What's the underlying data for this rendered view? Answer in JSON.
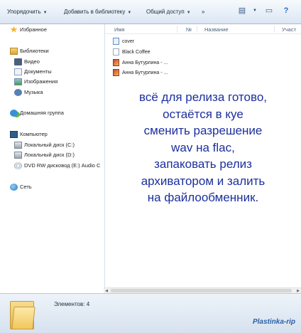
{
  "toolbar": {
    "organize": "Упорядочить",
    "add_to_library": "Добавить в библиотеку",
    "share": "Общий доступ",
    "more": "»"
  },
  "nav": {
    "favorites": "Избранное",
    "libraries": "Библиотеки",
    "video": "Видео",
    "documents": "Документы",
    "images": "Изображения",
    "music": "Музыка",
    "homegroup": "Домашняя группа",
    "computer": "Компьютер",
    "disk_c": "Локальный диск (C:)",
    "disk_d": "Локальный диск (D:)",
    "dvd": "DVD RW дисковод (E:) Audio C",
    "network": "Сеть"
  },
  "columns": {
    "name": "Имя",
    "number": "№",
    "title": "Название",
    "artist": "Участ"
  },
  "files": [
    {
      "name": "cover"
    },
    {
      "name": "Black Coffee"
    },
    {
      "name": "Анна Бутурлина - ..."
    },
    {
      "name": "Анна Бутурлина - ..."
    }
  ],
  "overlay": {
    "line1": "всё для релиза готово,",
    "line2": "остаётся в куе",
    "line3": "сменить разрешение",
    "line4": "wav на flac,",
    "line5": "запаковать релиз",
    "line6": "архиватором  и залить",
    "line7": "на файлообменник."
  },
  "status": {
    "count": "Элементов: 4",
    "watermark": "Plastinka-rip"
  }
}
